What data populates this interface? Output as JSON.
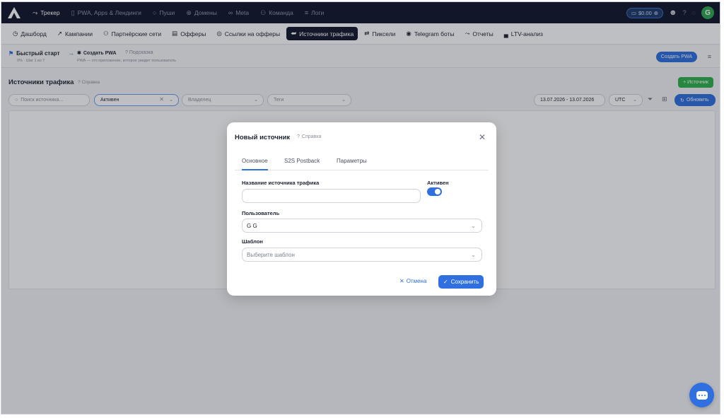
{
  "topnav": {
    "items": [
      {
        "icon": "chart-line-icon",
        "glyph": "⤳",
        "label": "Трекер",
        "active": true
      },
      {
        "icon": "phone-icon",
        "glyph": "▯",
        "label": "PWA, Apps & Лендинги",
        "active": false
      },
      {
        "icon": "bell-icon",
        "glyph": "○",
        "label": "Пуши",
        "active": false
      },
      {
        "icon": "globe-icon",
        "glyph": "⊕",
        "label": "Домены",
        "active": false
      },
      {
        "icon": "meta-icon",
        "glyph": "∞",
        "label": "Meta",
        "active": false
      },
      {
        "icon": "team-icon",
        "glyph": "⚇",
        "label": "Команда",
        "active": false
      },
      {
        "icon": "list-icon",
        "glyph": "≡",
        "label": "Логи",
        "active": false
      }
    ],
    "balance": "$0.00",
    "avatar_letter": "G"
  },
  "subnav": {
    "items": [
      {
        "name": "dashboard",
        "glyph": "◷",
        "label": "Дашборд",
        "active": false
      },
      {
        "name": "campaigns",
        "glyph": "↗",
        "label": "Кампании",
        "active": false
      },
      {
        "name": "partner-networks",
        "glyph": "⚇",
        "label": "Партнёрские сети",
        "active": false
      },
      {
        "name": "offers",
        "glyph": "▤",
        "label": "Офферы",
        "active": false
      },
      {
        "name": "offer-links",
        "glyph": "◎",
        "label": "Ссылки на офферы",
        "active": false
      },
      {
        "name": "traffic-sources",
        "glyph": "⮨",
        "label": "Источники трафика",
        "active": true
      },
      {
        "name": "pixels",
        "glyph": "⇄",
        "label": "Пиксели",
        "active": false
      },
      {
        "name": "telegram-bots",
        "glyph": "◉",
        "label": "Telegram боты",
        "active": false
      },
      {
        "name": "reports",
        "glyph": "⤳",
        "label": "Отчеты",
        "active": false
      },
      {
        "name": "ltv",
        "glyph": "▄",
        "label": "LTV-анализ",
        "active": false
      }
    ]
  },
  "quickstart": {
    "title": "Быстрый старт",
    "progress": "0% · Шаг 1 из 7",
    "step": "Создать PWA",
    "hint": "Подсказка",
    "description": "PWA — это приложение, которое увидит пользователь",
    "create_button": "Создать PWA"
  },
  "page": {
    "title": "Источники трафика",
    "help": "Справка",
    "add_button": "+ Источник"
  },
  "filters": {
    "search_placeholder": "Поиск источника...",
    "status_value": "Активен",
    "owner_placeholder": "Владелец",
    "tags_placeholder": "Теги",
    "date_range": "13.07.2026 - 13.07.2026",
    "timezone": "UTC",
    "refresh_button": "Обновить"
  },
  "modal": {
    "title": "Новый источник",
    "help": "Справка",
    "tabs": [
      "Основное",
      "S2S Postback",
      "Параметры"
    ],
    "name_label": "Название источника трафика",
    "name_value": "",
    "active_label": "Активен",
    "active": true,
    "user_label": "Пользователь",
    "user_value": "G G",
    "template_label": "Шаблон",
    "template_placeholder": "Выберите шаблон",
    "cancel_button": "Отмена",
    "save_button": "Сохранить"
  },
  "colors": {
    "accent": "#2f6fdf",
    "success": "#2fb24c",
    "topbar": "#10162a"
  }
}
